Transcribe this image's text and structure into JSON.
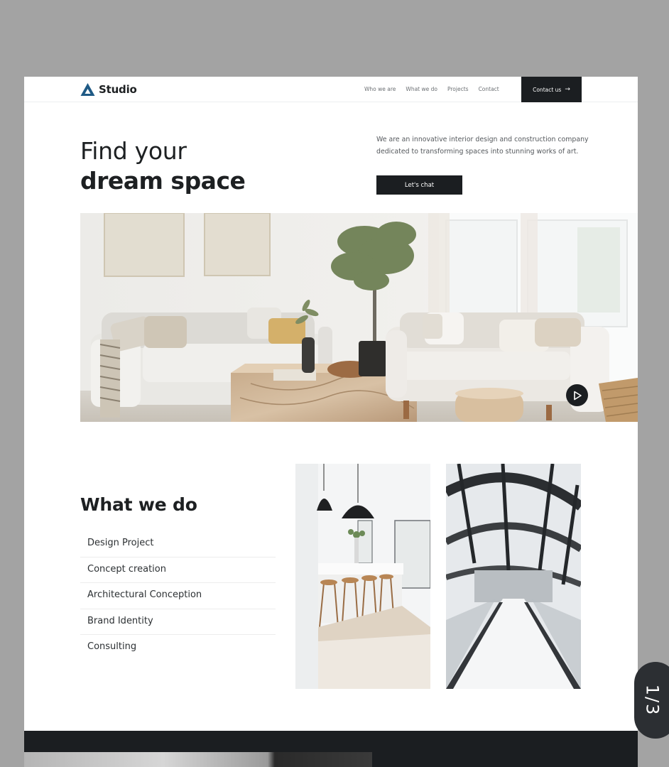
{
  "brand": {
    "name": "Studio",
    "accent": "#1f5a85"
  },
  "nav": {
    "items": [
      "Who we are",
      "What we do",
      "Projects",
      "Contact"
    ],
    "cta": "Contact us",
    "cta_icon": "arrow-right-icon"
  },
  "hero": {
    "title_line1": "Find your",
    "title_line2": "dream space",
    "description": "We are an innovative interior design and construction company dedicated to transforming spaces into stunning works of art.",
    "button": "Let's chat"
  },
  "what_we_do": {
    "title": "What we do",
    "services": [
      "Design Project",
      "Concept creation",
      "Architectural Conception",
      "Brand Identity",
      "Consulting"
    ]
  },
  "pager": {
    "label": "1/3"
  }
}
